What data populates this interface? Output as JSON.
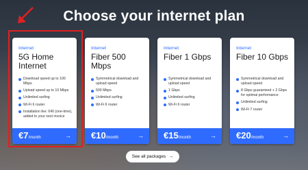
{
  "headline": "Choose your internet plan",
  "plans": [
    {
      "tag": "Internet",
      "name": "5G Home Internet",
      "features": [
        "Download speed up to 100 Mbps",
        "Upload speed up to 10 Mbps",
        "Unlimited surfing",
        "Wi-Fi 6 router",
        "Installation fee: €40 (one-time), added to your next invoice"
      ],
      "price": "€7",
      "per": "/month"
    },
    {
      "tag": "Internet",
      "name": "Fiber 500 Mbps",
      "features": [
        "Symmetrical download and upload speed",
        "500 Mbps",
        "Unlimited surfing",
        "Wi-Fi 6 router"
      ],
      "price": "€10",
      "per": "/month"
    },
    {
      "tag": "Internet",
      "name": "Fiber 1 Gbps",
      "features": [
        "Symmetrical download and upload speed",
        "1 Gbps",
        "Unlimited surfing",
        "Wi-Fi 6 router"
      ],
      "price": "€15",
      "per": "/month"
    },
    {
      "tag": "Internet",
      "name": "Fiber 10 Gbps",
      "features": [
        "Symmetrical download and upload speed",
        "8 Gbps guaranteed + 2 Gbps for optimal performance",
        "Unlimited surfing",
        "Wi-Fi 7 router"
      ],
      "price": "€20",
      "per": "/month"
    }
  ],
  "see_all": "See all packages",
  "colors": {
    "accent": "#2f6bff",
    "annotation": "#e02020"
  }
}
